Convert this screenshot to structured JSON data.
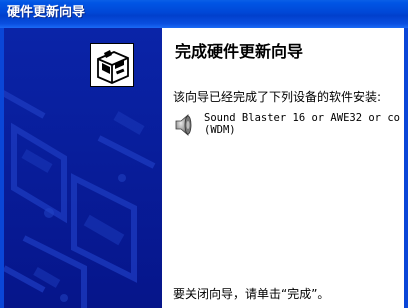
{
  "window": {
    "title": "硬件更新向导"
  },
  "wizard": {
    "heading": "完成硬件更新向导",
    "intro": "该向导已经完成了下列设备的软件安装:",
    "device": {
      "icon": "speaker-icon",
      "name_line1": "Sound Blaster 16 or AWE32 or co",
      "name_line2": "(WDM)"
    },
    "footer": "要关闭向导，请单击“完成”。"
  },
  "colors": {
    "titlebar": "#0055e5",
    "side_panel": "#041a8c",
    "content_bg": "#ffffff"
  },
  "icons": {
    "wizard_art": "hardware-box-icon"
  }
}
